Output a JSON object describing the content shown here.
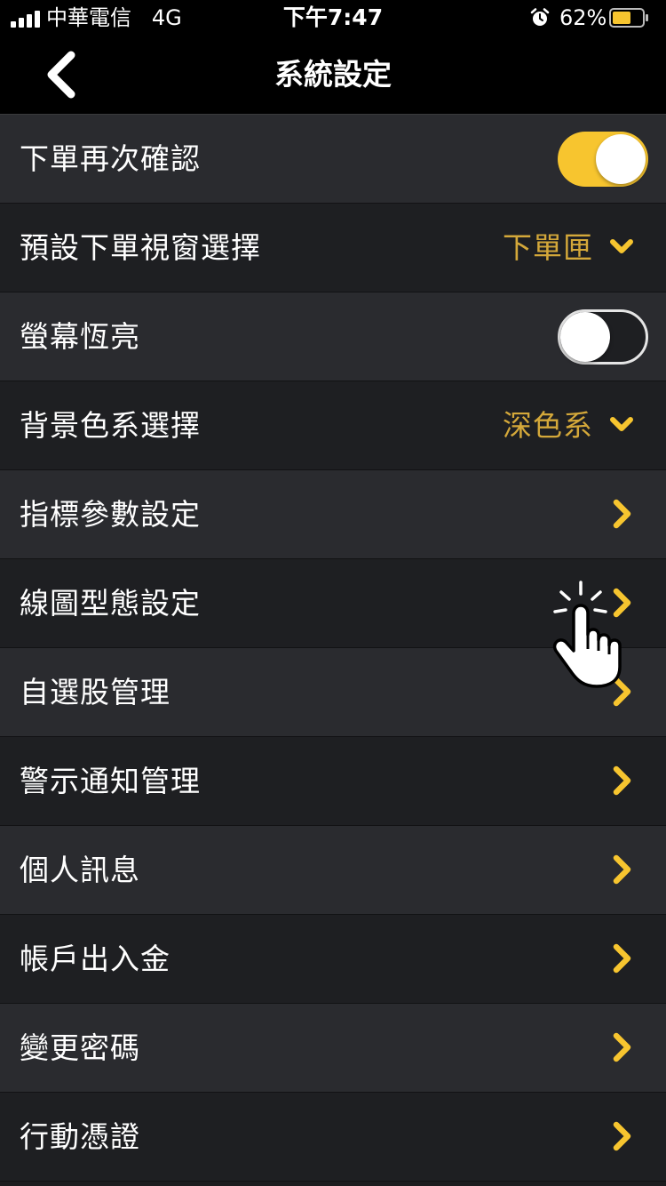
{
  "status_bar": {
    "carrier": "中華電信",
    "network": "4G",
    "time": "下午7:47",
    "battery_percent": "62%",
    "battery_level": 0.62
  },
  "nav": {
    "title": "系統設定",
    "back_icon": "chevron-left-icon"
  },
  "colors": {
    "accent": "#f7c52f",
    "dropdown_text": "#d4a83a",
    "row_light": "#2a2b2f",
    "row_dark": "#1e1f22"
  },
  "settings": [
    {
      "label": "下單再次確認",
      "type": "toggle",
      "on": true
    },
    {
      "label": "預設下單視窗選擇",
      "type": "dropdown",
      "value": "下單匣"
    },
    {
      "label": "螢幕恆亮",
      "type": "toggle",
      "on": false
    },
    {
      "label": "背景色系選擇",
      "type": "dropdown",
      "value": "深色系"
    },
    {
      "label": "指標參數設定",
      "type": "link"
    },
    {
      "label": "線圖型態設定",
      "type": "link"
    },
    {
      "label": "自選股管理",
      "type": "link"
    },
    {
      "label": "警示通知管理",
      "type": "link"
    },
    {
      "label": "個人訊息",
      "type": "link"
    },
    {
      "label": "帳戶出入金",
      "type": "link"
    },
    {
      "label": "變更密碼",
      "type": "link"
    },
    {
      "label": "行動憑證",
      "type": "link"
    }
  ]
}
